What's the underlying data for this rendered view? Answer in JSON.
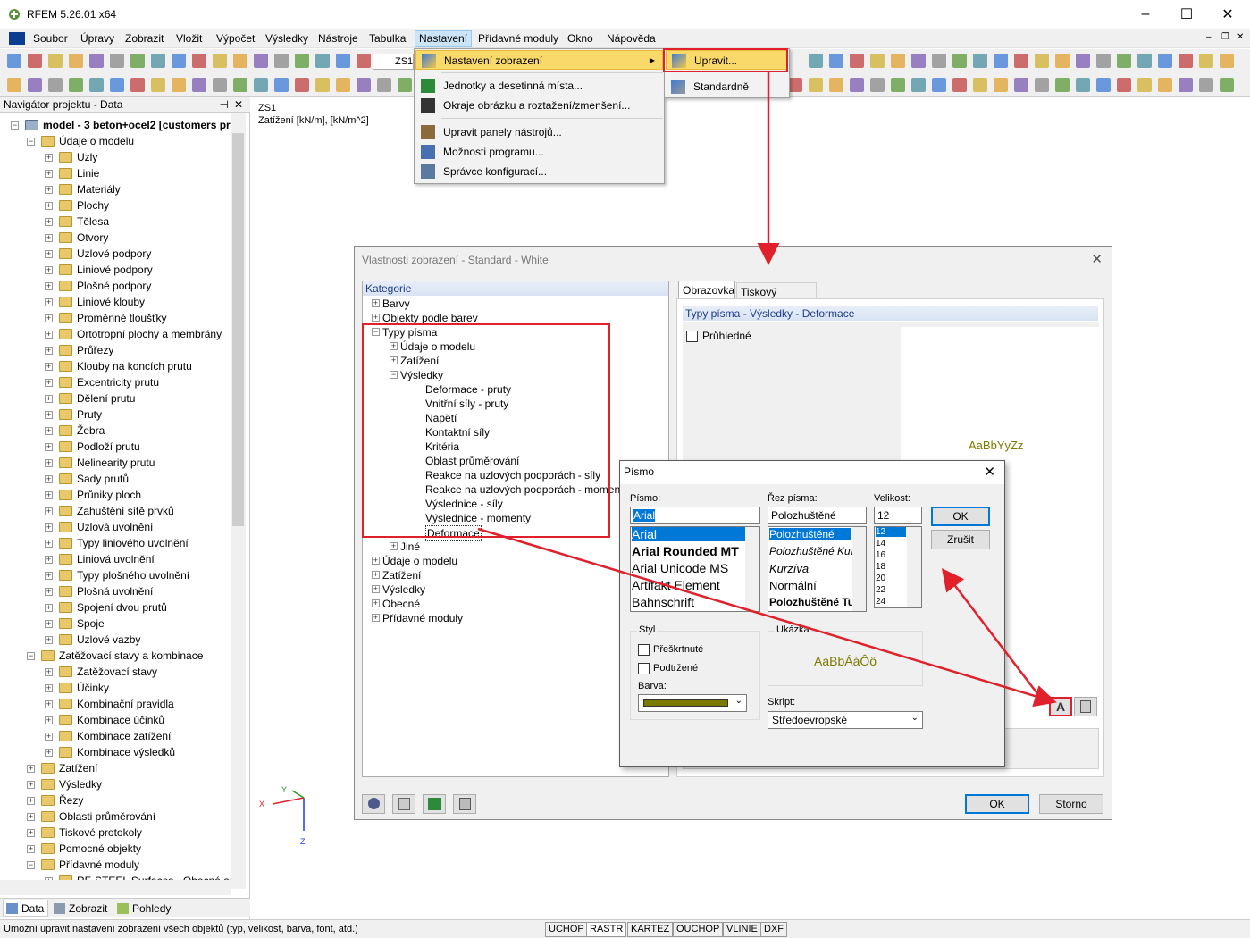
{
  "window": {
    "title": "RFEM 5.26.01 x64",
    "min": "–",
    "max": "☐",
    "close": "✕"
  },
  "menu": [
    "Soubor",
    "Úpravy",
    "Zobrazit",
    "Vložit",
    "Výpočet",
    "Výsledky",
    "Nástroje",
    "Tabulka",
    "Nastavení",
    "Přídavné moduly",
    "Okno",
    "Nápověda"
  ],
  "toolbar": {
    "lc_value": "ZS1"
  },
  "navigator": {
    "title": "Navigátor projektu - Data",
    "root": "model - 3 beton+ocel2 [customers pro",
    "items": [
      "Údaje o modelu",
      "Uzly",
      "Linie",
      "Materiály",
      "Plochy",
      "Tělesa",
      "Otvory",
      "Uzlové podpory",
      "Liniové podpory",
      "Plošné podpory",
      "Liniové klouby",
      "Proměnné tloušťky",
      "Ortotropní plochy a membrány",
      "Průřezy",
      "Klouby na koncích prutu",
      "Excentricity prutu",
      "Dělení prutu",
      "Pruty",
      "Žebra",
      "Podloží prutu",
      "Nelinearity prutu",
      "Sady prutů",
      "Průniky ploch",
      "Zahuštění sítě prvků",
      "Uzlová uvolnění",
      "Typy liniového uvolnění",
      "Liniová uvolnění",
      "Typy plošného uvolnění",
      "Plošná uvolnění",
      "Spojení dvou prutů",
      "Spoje",
      "Uzlové vazby",
      "Zatěžovací stavy a kombinace",
      "Zatěžovací stavy",
      "Účinky",
      "Kombinační pravidla",
      "Kombinace účinků",
      "Kombinace zatížení",
      "Kombinace výsledků",
      "Zatížení",
      "Výsledky",
      "Řezy",
      "Oblasti průměrování",
      "Tiskové protokoly",
      "Pomocné objekty",
      "Přídavné moduly",
      "RF-STEEL Surfaces - Obecná anal"
    ],
    "tabs": [
      "Data",
      "Zobrazit",
      "Pohledy"
    ]
  },
  "canvas": {
    "lc": "ZS1",
    "units": "Zatížení [kN/m], [kN/m^2]",
    "axes": [
      "X",
      "Y",
      "Z"
    ]
  },
  "dropdown": {
    "items": [
      "Nastavení zobrazení",
      "Jednotky a desetinná místa...",
      "Okraje obrázku a roztažení/zmenšení...",
      "Upravit panely nástrojů...",
      "Možnosti programu...",
      "Správce konfigurací..."
    ],
    "submenu": [
      "Upravit...",
      "Standardně"
    ]
  },
  "display_dialog": {
    "title": "Vlastnosti zobrazení - Standard - White",
    "category_header": "Kategorie",
    "tree": [
      "Barvy",
      "Objekty podle barev",
      "Typy písma",
      "Údaje o modelu",
      "Zatížení",
      "Výsledky",
      "Deformace - pruty",
      "Vnitřní síly - pruty",
      "Napětí",
      "Kontaktní síly",
      "Kritéria",
      "Oblast průměrování",
      "Reakce na uzlových podporách - síly",
      "Reakce na uzlových podporách - momenty",
      "Výslednice - síly",
      "Výslednice - momenty",
      "Deformace",
      "Jiné",
      "Údaje o modelu",
      "Zatížení",
      "Výsledky",
      "Obecné",
      "Přídavné moduly"
    ],
    "tabs": [
      "Obrazovka",
      "Tiskový protokol"
    ],
    "section": "Typy písma - Výsledky - Deformace",
    "transparent": "Průhledné",
    "sample": "AaBbYyZz",
    "ok": "OK",
    "cancel": "Storno"
  },
  "font_dialog": {
    "title": "Písmo",
    "font_label": "Písmo:",
    "font_value": "Arial",
    "fonts": [
      "Arial",
      "Arial Rounded MT",
      "Arial Unicode MS",
      "Artifakt Element",
      "Bahnschrift"
    ],
    "style_label": "Řez písma:",
    "style_value": "Polozhuštěné",
    "styles": [
      "Polozhuštěné",
      "Polozhuštěné Kurzíva",
      "Kurzíva",
      "Normální",
      "Polozhuštěné Tučné"
    ],
    "size_label": "Velikost:",
    "size_value": "12",
    "sizes": [
      "12",
      "14",
      "16",
      "18",
      "20",
      "22",
      "24"
    ],
    "ok": "OK",
    "cancel": "Zrušit",
    "style_group": "Styl",
    "strike": "Přeškrtnuté",
    "underline": "Podtržené",
    "color_label": "Barva:",
    "preview_label": "Ukázka",
    "preview": "AaBbÁáÔô",
    "script_label": "Skript:",
    "script_value": "Středoevropské"
  },
  "statusbar": {
    "message": "Umožní upravit nastavení zobrazení všech objektů (typ, velikost, barva, font, atd.)",
    "buttons": [
      "UCHOP",
      "RASTR",
      "KARTEZ",
      "OUCHOP",
      "VLINIE",
      "DXF"
    ]
  },
  "colors": {
    "accent": "#e0202a",
    "highlight": "#f9d96a",
    "font_color": "#7a7a00",
    "folder": "#e8c86a"
  }
}
